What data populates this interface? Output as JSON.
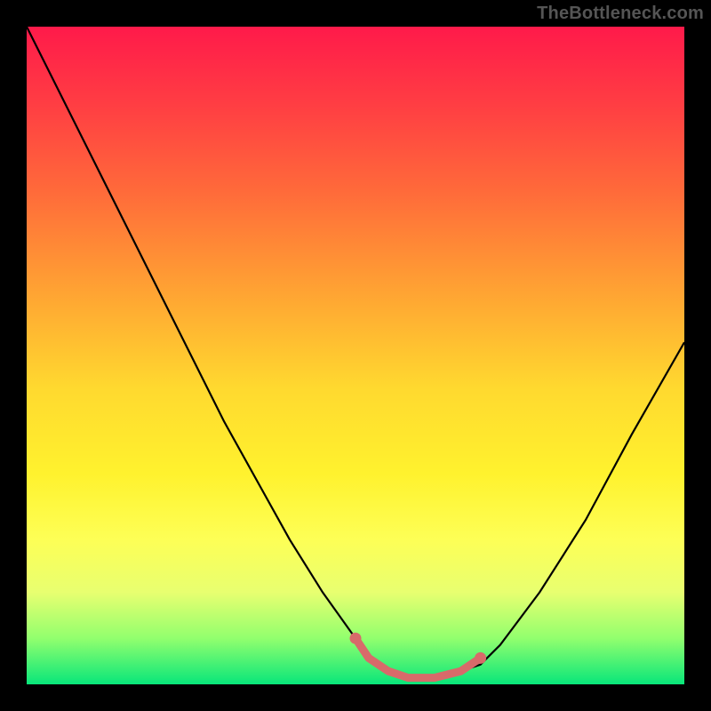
{
  "watermark": "TheBottleneck.com",
  "colors": {
    "frame": "#000000",
    "curve": "#000000",
    "marker": "#d86a6a",
    "gradient_top": "#ff1a4a",
    "gradient_bottom": "#08e67a"
  },
  "chart_data": {
    "type": "line",
    "title": "",
    "xlabel": "",
    "ylabel": "",
    "xlim": [
      0,
      100
    ],
    "ylim": [
      0,
      100
    ],
    "series": [
      {
        "name": "bottleneck-curve",
        "x": [
          0,
          5,
          10,
          15,
          20,
          25,
          30,
          35,
          40,
          45,
          50,
          52,
          55,
          58,
          62,
          66,
          69,
          72,
          78,
          85,
          92,
          100
        ],
        "y": [
          100,
          90,
          80,
          70,
          60,
          50,
          40,
          31,
          22,
          14,
          7,
          4,
          2,
          1,
          1,
          2,
          3,
          6,
          14,
          25,
          38,
          52
        ]
      }
    ],
    "markers": {
      "name": "valley-highlight",
      "x": [
        50,
        52,
        55,
        58,
        62,
        66,
        69
      ],
      "y": [
        7,
        4,
        2,
        1,
        1,
        2,
        4
      ]
    },
    "grid": false,
    "legend": false
  }
}
